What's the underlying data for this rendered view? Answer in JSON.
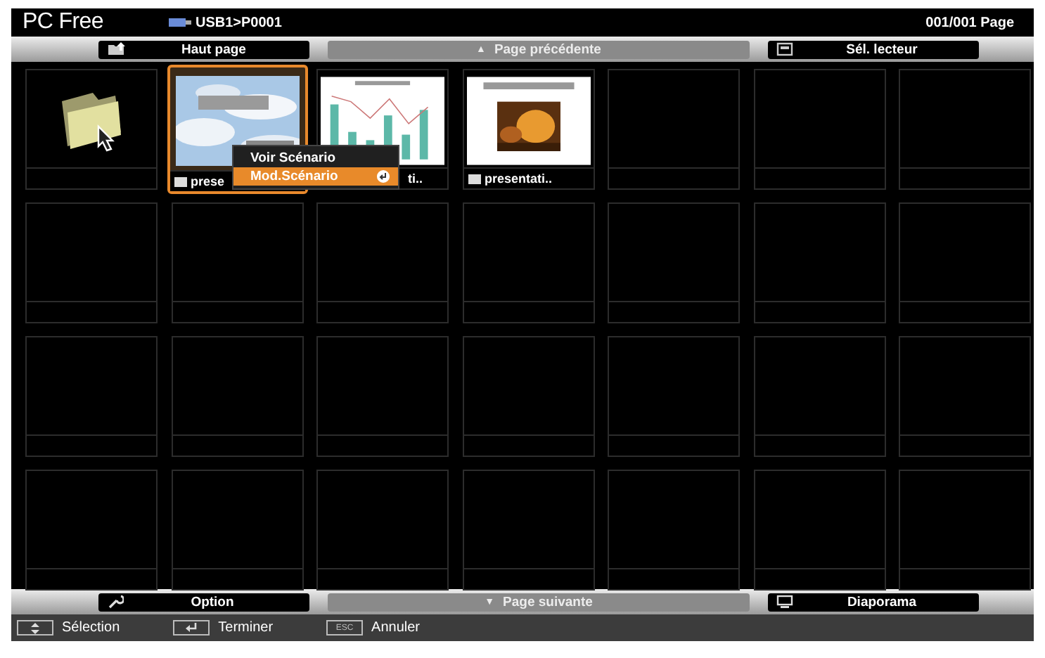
{
  "header": {
    "title": "PC Free",
    "path": "USB1>P0001",
    "page": "001/001 Page"
  },
  "top_buttons": [
    {
      "kind": "up",
      "label": "Haut page",
      "disabled": false
    },
    {
      "kind": "prev",
      "glyph": "▲",
      "label": "Page précédente",
      "disabled": true
    },
    {
      "kind": "drive",
      "label": "Sél. lecteur",
      "disabled": false
    }
  ],
  "cells": [
    {
      "kind": "folder"
    },
    {
      "kind": "sky-slide",
      "label": "prese",
      "selected": true,
      "covered": false
    },
    {
      "kind": "chart-slide",
      "label": "ti..",
      "selected": false,
      "covered": true
    },
    {
      "kind": "photo-slide",
      "label": "presentati..",
      "selected": false,
      "covered": false
    },
    {
      "kind": "empty"
    },
    {
      "kind": "empty"
    },
    {
      "kind": "empty"
    },
    {
      "kind": "empty"
    },
    {
      "kind": "empty"
    },
    {
      "kind": "empty"
    },
    {
      "kind": "empty"
    },
    {
      "kind": "empty"
    },
    {
      "kind": "empty"
    },
    {
      "kind": "empty"
    },
    {
      "kind": "empty"
    },
    {
      "kind": "empty"
    },
    {
      "kind": "empty"
    },
    {
      "kind": "empty"
    },
    {
      "kind": "empty"
    },
    {
      "kind": "empty"
    },
    {
      "kind": "empty"
    },
    {
      "kind": "empty"
    },
    {
      "kind": "empty"
    },
    {
      "kind": "empty"
    },
    {
      "kind": "empty"
    },
    {
      "kind": "empty"
    },
    {
      "kind": "empty"
    },
    {
      "kind": "empty"
    }
  ],
  "context_menu": [
    {
      "label": "Voir Scénario",
      "selected": false
    },
    {
      "label": "Mod.Scénario",
      "selected": true
    }
  ],
  "bottom_buttons": [
    {
      "kind": "option",
      "label": "Option",
      "disabled": false
    },
    {
      "kind": "next",
      "glyph": "▼",
      "label": "Page suivante",
      "disabled": true
    },
    {
      "kind": "slideshow",
      "label": "Diaporama",
      "disabled": false
    }
  ],
  "hints": [
    {
      "kind": "updown",
      "label": "Sélection"
    },
    {
      "kind": "enter",
      "label": "Terminer"
    },
    {
      "kind": "esc",
      "key": "ESC",
      "label": "Annuler"
    }
  ]
}
